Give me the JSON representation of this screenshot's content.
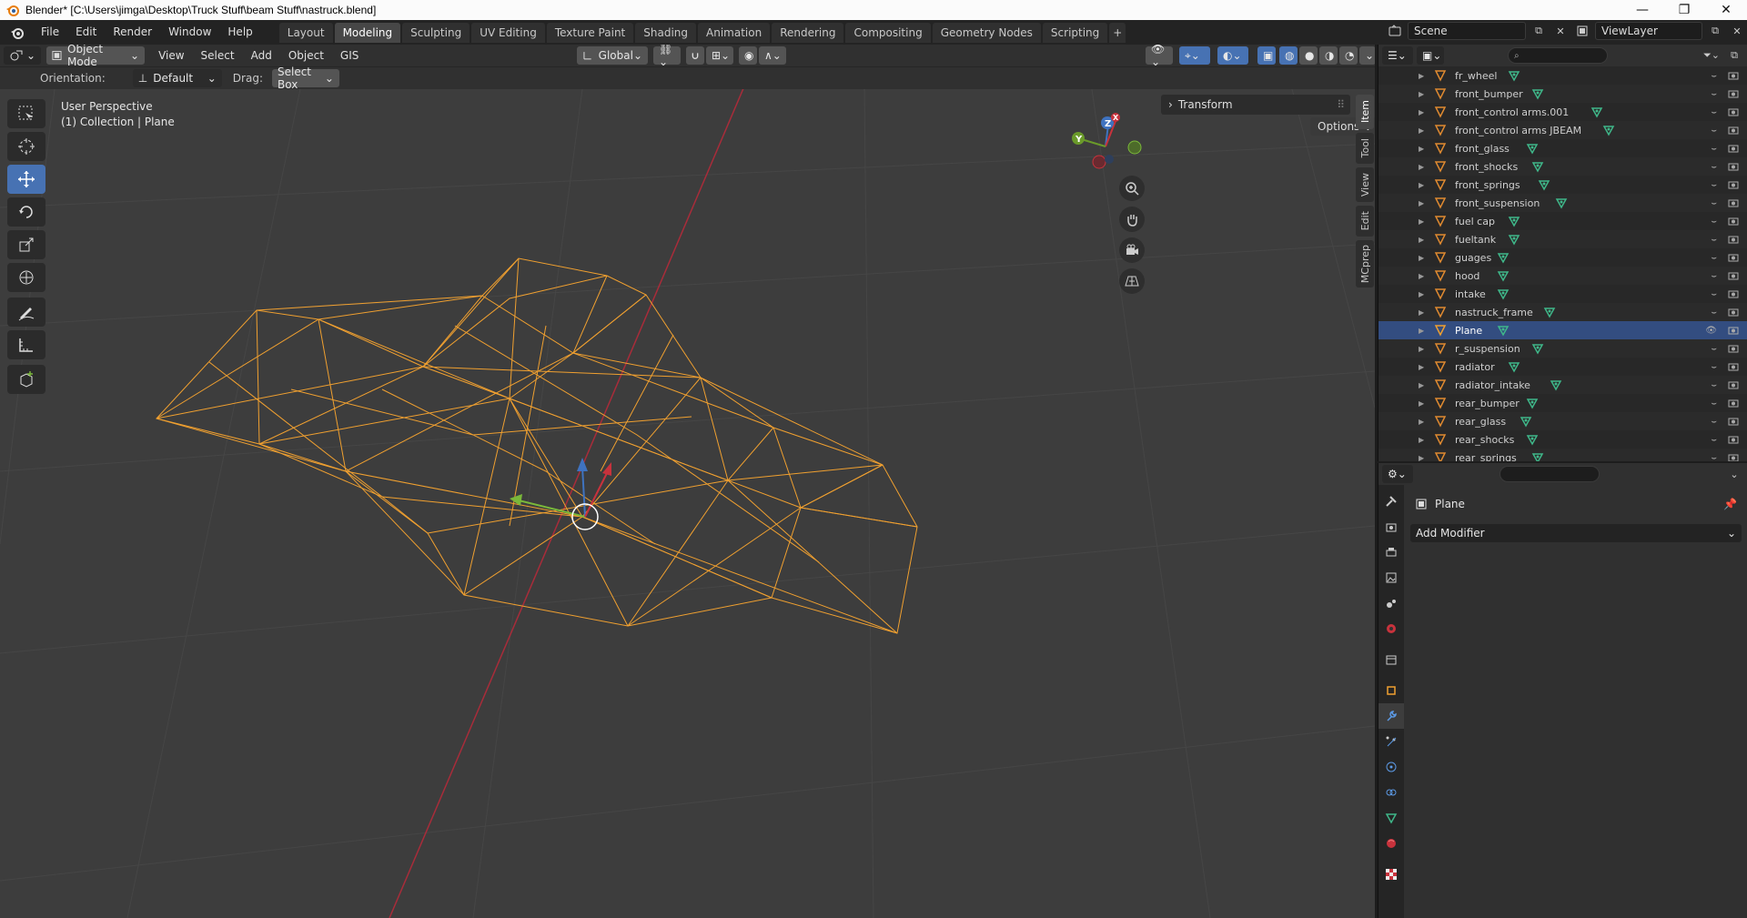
{
  "window": {
    "title": "Blender* [C:\\Users\\jimga\\Desktop\\Truck Stuff\\beam Stuff\\nastruck.blend]",
    "controls": [
      "—",
      "❐",
      "✕"
    ]
  },
  "menubar": {
    "items": [
      "File",
      "Edit",
      "Render",
      "Window",
      "Help"
    ]
  },
  "workspaces": {
    "tabs": [
      "Layout",
      "Modeling",
      "Sculpting",
      "UV Editing",
      "Texture Paint",
      "Shading",
      "Animation",
      "Rendering",
      "Compositing",
      "Geometry Nodes",
      "Scripting"
    ],
    "active": "Modeling",
    "add_label": "+"
  },
  "scene": {
    "name": "Scene",
    "view_layer": "ViewLayer"
  },
  "viewport_header": {
    "mode": "Object Mode",
    "menus": [
      "View",
      "Select",
      "Add",
      "Object",
      "GIS"
    ],
    "transform_orientation": "Global"
  },
  "tool_settings": {
    "orientation_label": "Orientation:",
    "orientation_value": "Default",
    "drag_label": "Drag:",
    "drag_value": "Select Box",
    "options_label": "Options"
  },
  "viewport": {
    "view_name": "User Perspective",
    "collection_info": "(1) Collection | Plane",
    "transform_panel": "Transform",
    "sidebar_tabs": [
      "Item",
      "Tool",
      "View",
      "Edit",
      "MCprep"
    ],
    "active_sidebar_tab": "Item",
    "gizmo_axes": [
      "X",
      "Y",
      "Z"
    ]
  },
  "toolbar": {
    "tools": [
      "select-box",
      "cursor",
      "move",
      "rotate",
      "scale",
      "transform",
      "annotate",
      "measure",
      "add-cube"
    ],
    "active": "move"
  },
  "outliner": {
    "items": [
      {
        "name": "fr_wheel"
      },
      {
        "name": "front_bumper"
      },
      {
        "name": "front_control arms.001"
      },
      {
        "name": "front_control arms JBEAM"
      },
      {
        "name": "front_glass"
      },
      {
        "name": "front_shocks"
      },
      {
        "name": "front_springs"
      },
      {
        "name": "front_suspension"
      },
      {
        "name": "fuel cap"
      },
      {
        "name": "fueltank"
      },
      {
        "name": "guages"
      },
      {
        "name": "hood"
      },
      {
        "name": "intake"
      },
      {
        "name": "nastruck_frame"
      },
      {
        "name": "Plane",
        "selected": true
      },
      {
        "name": "r_suspension"
      },
      {
        "name": "radiator"
      },
      {
        "name": "radiator_intake"
      },
      {
        "name": "rear_bumper"
      },
      {
        "name": "rear_glass"
      },
      {
        "name": "rear_shocks"
      },
      {
        "name": "rear_springs"
      }
    ]
  },
  "properties": {
    "object_name": "Plane",
    "add_modifier_label": "Add Modifier",
    "active_tab": "modifiers"
  },
  "colors": {
    "wire_selected": "#f0a030",
    "accent_blue": "#4772b3",
    "x_axis": "#a82c3a",
    "y_axis": "#6a9a2a",
    "z_axis": "#3f73c0"
  }
}
